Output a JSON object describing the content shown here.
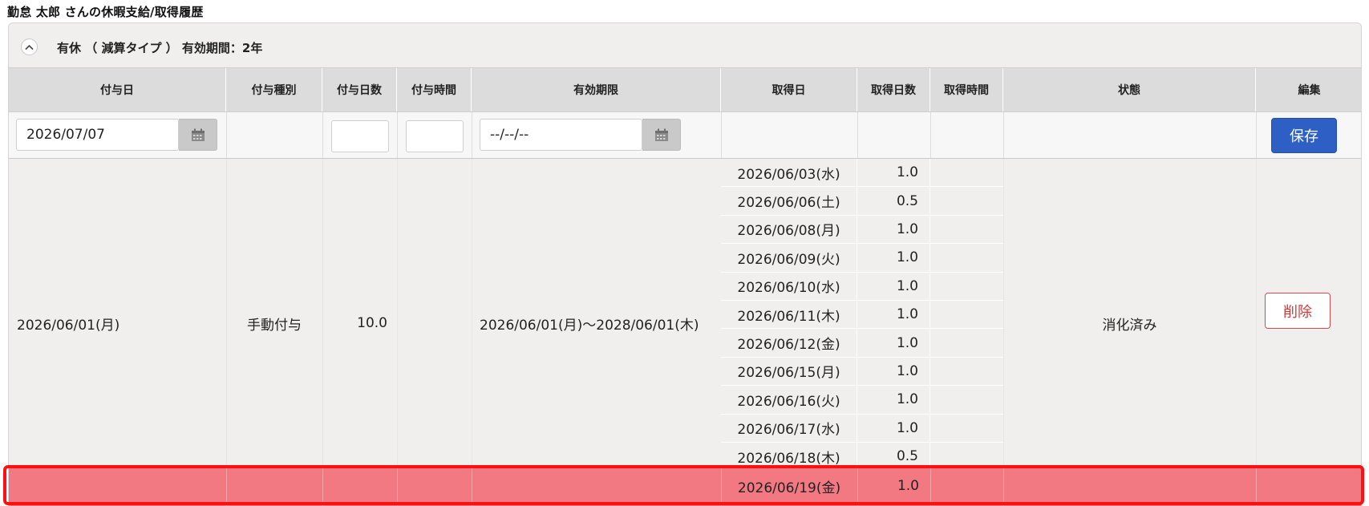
{
  "page": {
    "title": "勤怠 太郎 さんの休暇支給/取得履歴"
  },
  "panel": {
    "header_text": "有休 （ 減算タイプ ） 有効期間：2年",
    "collapse_icon": "chevron-up-icon"
  },
  "table": {
    "headers": {
      "grant_date": "付与日",
      "grant_type": "付与種別",
      "grant_days": "付与日数",
      "grant_hours": "付与時間",
      "expiry": "有効期限",
      "take_date": "取得日",
      "take_days": "取得日数",
      "take_hours": "取得時間",
      "status": "状態",
      "edit": "編集"
    }
  },
  "input_row": {
    "grant_date_value": "2026/07/07",
    "grant_days_value": "",
    "grant_hours_value": "",
    "expiry_value": "--/--/--",
    "save_label": "保存"
  },
  "grant": {
    "date": "2026/06/01(月)",
    "type": "手動付与",
    "days": "10.0",
    "hours": "",
    "expiry": "2026/06/01(月)〜2028/06/01(木)",
    "status": "消化済み",
    "delete_label": "削除"
  },
  "takes": [
    {
      "date": "2026/06/03(水)",
      "days": "1.0",
      "hours": ""
    },
    {
      "date": "2026/06/06(土)",
      "days": "0.5",
      "hours": ""
    },
    {
      "date": "2026/06/08(月)",
      "days": "1.0",
      "hours": ""
    },
    {
      "date": "2026/06/09(火)",
      "days": "1.0",
      "hours": ""
    },
    {
      "date": "2026/06/10(水)",
      "days": "1.0",
      "hours": ""
    },
    {
      "date": "2026/06/11(木)",
      "days": "1.0",
      "hours": ""
    },
    {
      "date": "2026/06/12(金)",
      "days": "1.0",
      "hours": ""
    },
    {
      "date": "2026/06/15(月)",
      "days": "1.0",
      "hours": ""
    },
    {
      "date": "2026/06/16(火)",
      "days": "1.0",
      "hours": ""
    },
    {
      "date": "2026/06/17(水)",
      "days": "1.0",
      "hours": ""
    },
    {
      "date": "2026/06/18(木)",
      "days": "0.5",
      "hours": ""
    }
  ],
  "highlighted_take": {
    "date": "2026/06/19(金)",
    "days": "1.0",
    "hours": ""
  },
  "colors": {
    "save_button": "#2d5fc4",
    "delete_button_border": "#d94a4a",
    "highlight_row": "#f27882",
    "highlight_outline": "#ff1010"
  }
}
